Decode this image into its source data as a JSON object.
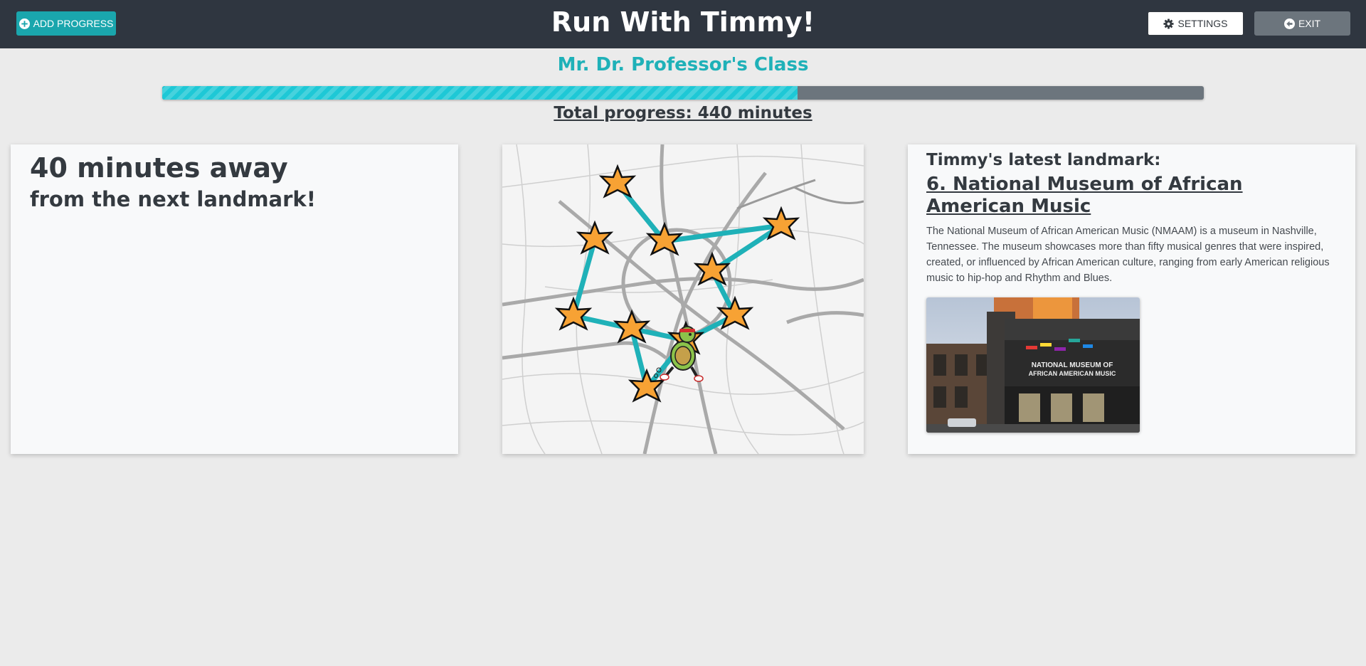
{
  "header": {
    "title": "Run With Timmy!",
    "add_progress_label": "ADD PROGRESS",
    "settings_label": "SETTINGS",
    "exit_label": "EXIT"
  },
  "class_name": "Mr. Dr. Professor's Class",
  "progress": {
    "percent": 61,
    "total_text": "Total progress: 440 minutes"
  },
  "next_landmark": {
    "minutes_text": "40 minutes away",
    "subtitle": "from the next landmark!"
  },
  "latest_landmark": {
    "label": "Timmy's latest landmark:",
    "title": "6. National Museum of African American Music",
    "description": "The National Museum of African American Music (NMAAM) is a museum in Nashville, Tennessee. The museum showcases more than fifty musical genres that were inspired, created, or influenced by African American culture, ranging from early American religious music to hip-hop and Rhythm and Blues.",
    "photo_sign_text": "NATIONAL MUSEUM OF AFRICAN AMERICAN MUSIC"
  },
  "map": {
    "route_color": "#1fb1b8",
    "star_color": "#f7a234",
    "icons": [
      "star-icon",
      "turtle-runner-icon"
    ]
  },
  "colors": {
    "accent": "#1aa6ad",
    "header_bg": "#2f3640",
    "progress_fill": "#1ec8d6"
  }
}
